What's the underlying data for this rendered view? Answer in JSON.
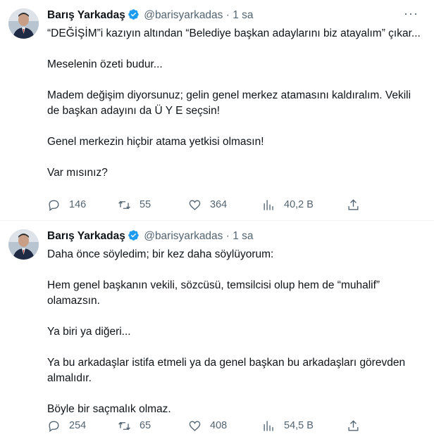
{
  "tweets": [
    {
      "author_name": "Barış Yarkadaş",
      "handle": "@barisyarkadas",
      "separator": "·",
      "time": "1 sa",
      "paragraphs": [
        "“DEĞİŞİM”i kazıyın altından “Belediye başkan adaylarını biz atayalım” çıkar...",
        "Meselenin özeti budur...",
        "Madem değişim diyorsunuz; gelin genel merkez atamasını kaldıralım. Vekili de başkan adayını da Ü Y E seçsin!",
        "Genel merkezin hiçbir atama yetkisi olmasın!",
        "Var mısınız?"
      ],
      "replies": "146",
      "retweets": "55",
      "likes": "364",
      "views": "40,2 B"
    },
    {
      "author_name": "Barış Yarkadaş",
      "handle": "@barisyarkadas",
      "separator": "·",
      "time": "1 sa",
      "paragraphs": [
        "Daha önce söyledim; bir kez daha söylüyorum:",
        "Hem genel başkanın vekili, sözcüsü, temsilcisi olup hem de “muhalif” olamazsın.",
        "Ya biri ya diğeri...",
        "Ya bu arkadaşlar istifa etmeli ya da genel başkan bu arkadaşları görevden almalıdır.",
        "Böyle bir saçmalık olmaz."
      ],
      "replies": "254",
      "retweets": "65",
      "likes": "408",
      "views": "54,5 B"
    }
  ],
  "colors": {
    "text": "#0f1419",
    "secondary": "#536471",
    "verified": "#1d9bf0",
    "divider": "#eff3f4"
  },
  "icons": [
    "avatar",
    "verified-badge-icon",
    "more-icon",
    "reply-icon",
    "retweet-icon",
    "like-icon",
    "views-icon",
    "share-icon"
  ]
}
